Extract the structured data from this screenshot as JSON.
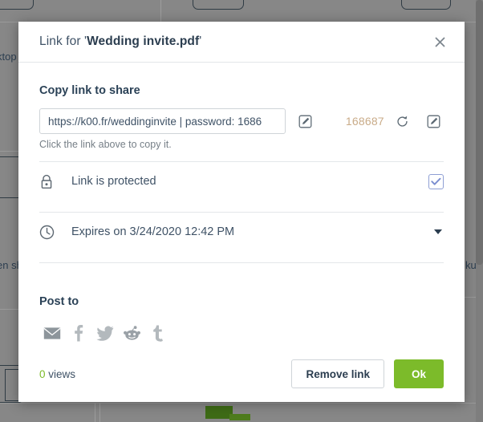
{
  "background": {
    "label_left_top": "ktop",
    "label_left_mid": "en sh",
    "label_right": "kup"
  },
  "modal": {
    "title_prefix": "Link for '",
    "file_name": "Wedding invite.pdf",
    "title_suffix": "'",
    "close_icon": "close-icon",
    "share": {
      "heading": "Copy link to share",
      "link_value": "https://k00.fr/weddinginvite | password: 1686",
      "link_placeholder": "https://",
      "edit_link_icon": "edit-icon",
      "password_value": "168687",
      "refresh_icon": "refresh-icon",
      "edit_password_icon": "edit-icon",
      "hint": "Click the link above to copy it."
    },
    "options": [
      {
        "icon": "lock-icon",
        "label": "Link is protected",
        "control": "checkbox",
        "checked": true
      },
      {
        "icon": "clock-icon",
        "label": "Expires on 3/24/2020 12:42 PM",
        "control": "dropdown",
        "checked": false
      }
    ],
    "post": {
      "heading": "Post to",
      "networks": [
        {
          "name": "email",
          "icon": "email-icon",
          "glyph": "✉"
        },
        {
          "name": "facebook",
          "icon": "facebook-icon",
          "glyph": "f"
        },
        {
          "name": "twitter",
          "icon": "twitter-icon",
          "glyph": "t"
        },
        {
          "name": "reddit",
          "icon": "reddit-icon",
          "glyph": "r"
        },
        {
          "name": "tumblr",
          "icon": "tumblr-icon",
          "glyph": "t"
        }
      ]
    },
    "footer": {
      "views_count": "0",
      "views_label": " views",
      "remove_label": "Remove link",
      "ok_label": "Ok"
    }
  },
  "colors": {
    "accent_green": "#7cbb2a",
    "password_tan": "#c9ab88",
    "text_navy": "#2b4257",
    "checkbox_blue": "#8f9fd4"
  }
}
